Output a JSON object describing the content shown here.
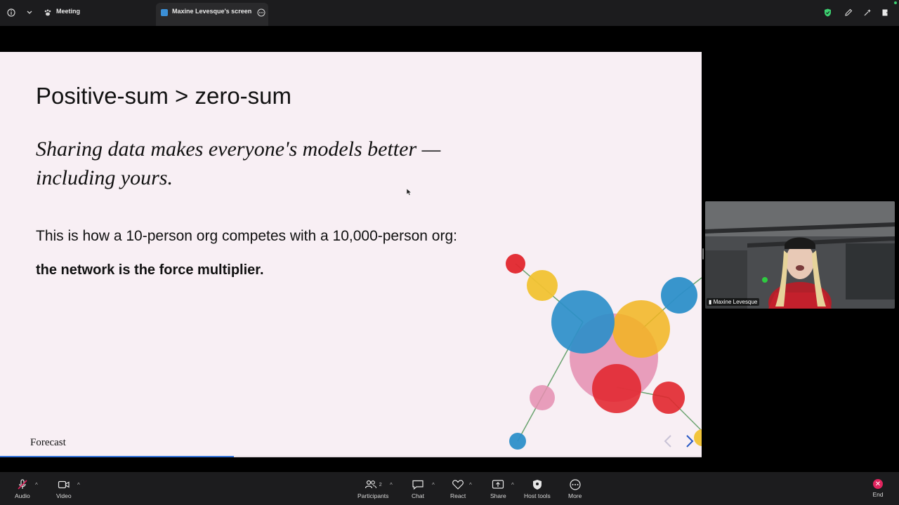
{
  "topbar": {
    "meeting_label": "Meeting",
    "share_tab_label": "Maxine Levesque's screen"
  },
  "slide": {
    "title": "Positive-sum > zero-sum",
    "quote": "Sharing data makes everyone's models better — including yours.",
    "line1": "This is how a 10-person org competes with a 10,000-person org:",
    "line2": "the network is the force multiplier.",
    "logo": "Forecast",
    "progress_fraction": 0.333
  },
  "participant": {
    "name": "Maxine Levesque"
  },
  "toolbar": {
    "audio": "Audio",
    "video": "Video",
    "participants": "Participants",
    "participants_count": "2",
    "chat": "Chat",
    "react": "React",
    "share": "Share",
    "host_tools": "Host tools",
    "more": "More",
    "end": "End"
  },
  "colors": {
    "accent": "#2f6fd6",
    "end": "#e0245e",
    "shield": "#3cd070"
  }
}
